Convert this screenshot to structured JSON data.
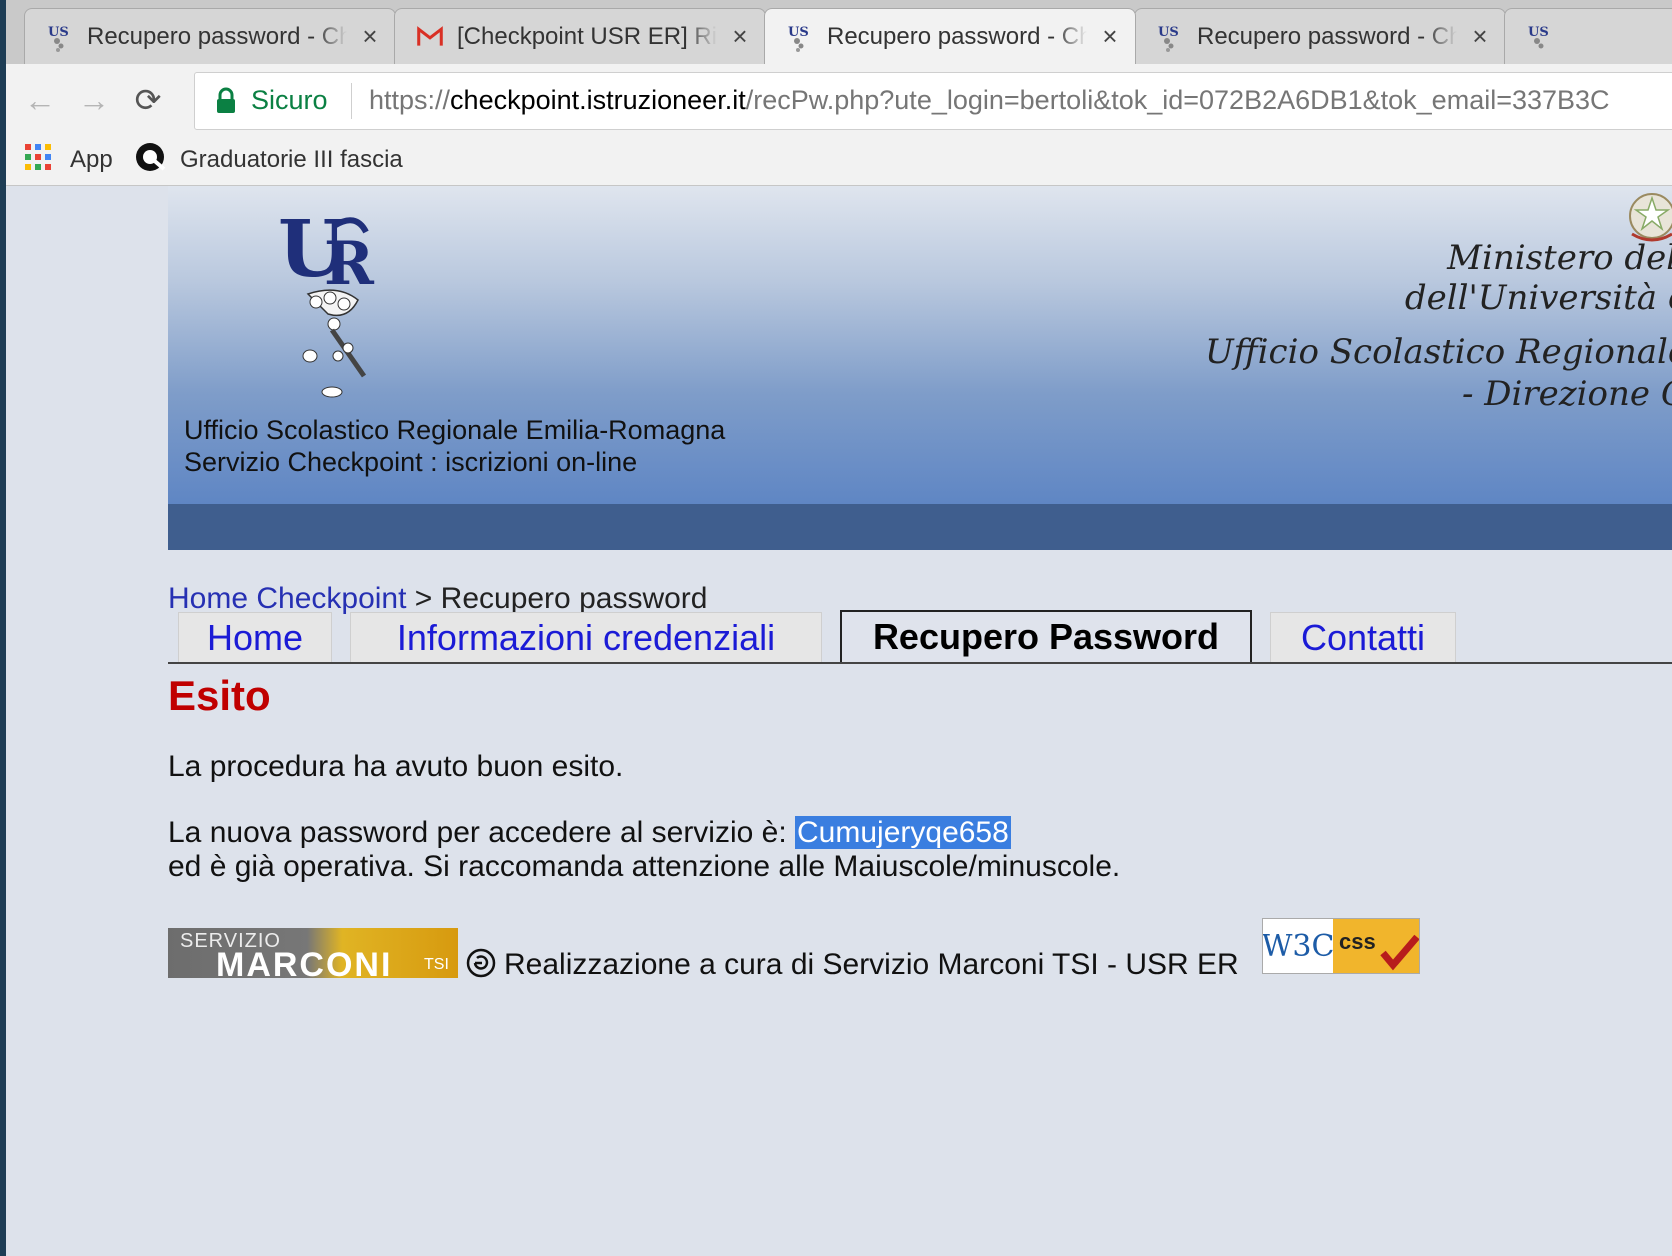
{
  "browser": {
    "tabs": [
      {
        "title": "Recupero password - Checkpoint",
        "icon": "usr-favicon",
        "close": "×",
        "active": false
      },
      {
        "title": "[Checkpoint USR ER] Richiesta",
        "icon": "gmail-icon",
        "close": "×",
        "active": false
      },
      {
        "title": "Recupero password - Checkpoint",
        "icon": "usr-favicon",
        "close": "×",
        "active": true
      },
      {
        "title": "Recupero password - Checkpoint",
        "icon": "usr-favicon",
        "close": "×",
        "active": false
      }
    ],
    "nav": {
      "back": "←",
      "forward": "→",
      "reload": "⟳"
    },
    "security_label": "Sicuro",
    "url": {
      "scheme": "https://",
      "host": "checkpoint.istruzioneer.it",
      "path": "/recPw.php?ute_login=bertoli&tok_id=072B2A6DB1&tok_email=337B3C"
    },
    "bookmarks": [
      {
        "label": "App",
        "icon": "apps-grid-icon"
      },
      {
        "label": "Graduatorie III fascia",
        "icon": "site-icon"
      }
    ]
  },
  "header": {
    "line1": "Ufficio Scolastico Regionale Emilia-Romagna",
    "line2": "Servizio Checkpoint : iscrizioni on-line",
    "ministry_lines": [
      "Ministero dell",
      "dell'Università e",
      "Ufficio Scolastico Regionale",
      "- Direzione G"
    ]
  },
  "breadcrumb": {
    "home": "Home Checkpoint",
    "separator": " > ",
    "current": "Recupero password"
  },
  "menu": [
    {
      "label": "Home",
      "active": false
    },
    {
      "label": "Informazioni credenziali",
      "active": false
    },
    {
      "label": "Recupero Password",
      "active": true
    },
    {
      "label": "Contatti",
      "active": false
    }
  ],
  "content": {
    "heading": "Esito",
    "line1": "La procedura ha avuto buon esito.",
    "line2_prefix": "La nuova password per accedere al servizio è: ",
    "password": "Cumujeryqe658",
    "line3": "ed è già operativa. Si raccomanda attenzione alle Maiuscole/minuscole."
  },
  "footer": {
    "logo_top": "SERVIZIO",
    "logo_main": "MARCONI",
    "logo_suffix": "TSI",
    "credit": "Realizzazione a cura di Servizio Marconi TSI - USR ER",
    "w3c_left": "W3C",
    "w3c_right": "css"
  },
  "colors": {
    "accent_link": "#2630b3",
    "heading_red": "#c00000",
    "selection": "#3a7ee0",
    "secure_green": "#0b8043"
  }
}
